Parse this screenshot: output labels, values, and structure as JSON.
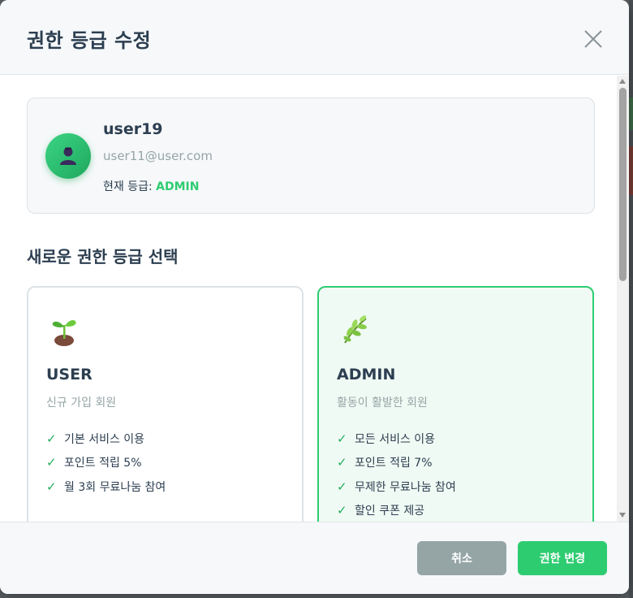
{
  "modal": {
    "title": "권한 등급 수정",
    "close_icon": "close-icon"
  },
  "user": {
    "name": "user19",
    "email": "user11@user.com",
    "current_grade_label": "현재 등급:",
    "current_grade_value": "ADMIN",
    "avatar_icon": "user-avatar-icon"
  },
  "section_title": "새로운 권한 등급 선택",
  "grades": [
    {
      "icon": "seedling-icon",
      "name": "USER",
      "description": "신규 가입 회원",
      "benefits": [
        "기본 서비스 이용",
        "포인트 적립 5%",
        "월 3회 무료나눔 참여"
      ],
      "selected": false
    },
    {
      "icon": "herb-icon",
      "name": "ADMIN",
      "description": "활동이 활발한 회원",
      "benefits": [
        "모든 서비스 이용",
        "포인트 적립 7%",
        "무제한 무료나눔 참여",
        "할인 쿠폰 제공"
      ],
      "selected": true
    }
  ],
  "check_mark": "✓",
  "footer": {
    "cancel_label": "취소",
    "submit_label": "권한 변경"
  },
  "colors": {
    "accent": "#2ecc71",
    "text": "#2c3e50",
    "muted": "#95a5a6",
    "cancel": "#95a5a6"
  }
}
